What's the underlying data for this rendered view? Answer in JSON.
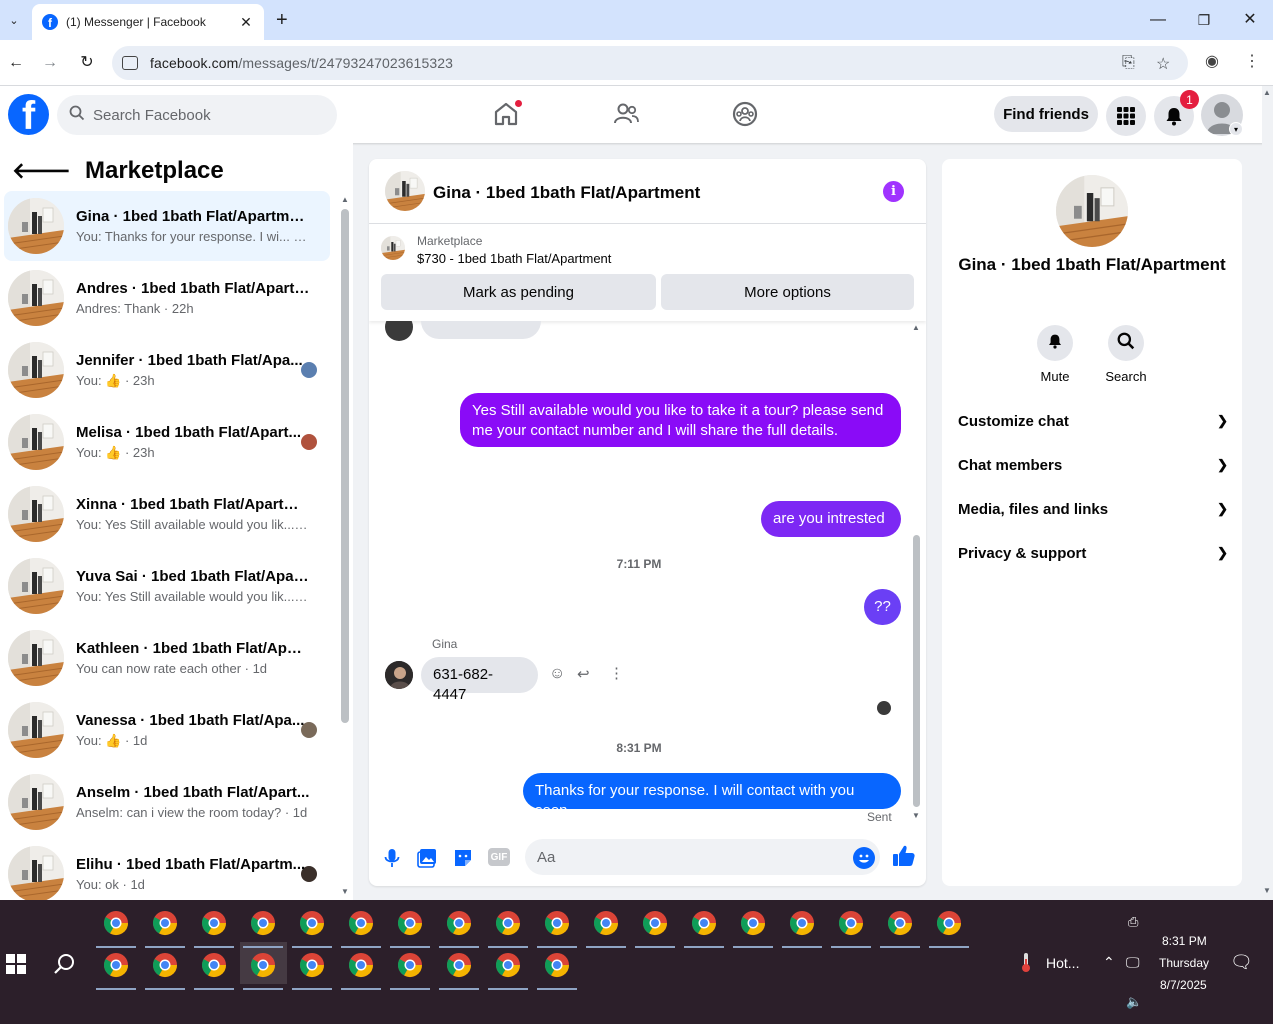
{
  "browser": {
    "tab_title": "(1) Messenger | Facebook",
    "url_host": "facebook.com",
    "url_path": "/messages/t/24793247023615323"
  },
  "header": {
    "search_placeholder": "Search Facebook",
    "find_friends": "Find friends",
    "notifications_count": "1"
  },
  "sidebar": {
    "title": "Marketplace",
    "conversations": [
      {
        "name": "Gina · 1bed 1bath Flat/Apartment",
        "preview": "You: Thanks for your response. I wi... · 1m",
        "active": true
      },
      {
        "name": "Andres · 1bed 1bath Flat/Apartm...",
        "preview": "Andres: Thank · 22h"
      },
      {
        "name": "Jennifer · 1bed 1bath Flat/Apa...",
        "preview": "You: 👍 · 23h"
      },
      {
        "name": "Melisa · 1bed 1bath Flat/Apart...",
        "preview": "You: 👍 · 23h"
      },
      {
        "name": "Xinna · 1bed 1bath Flat/Apartment",
        "preview": "You: Yes Still available would you lik... · 1d"
      },
      {
        "name": "Yuva Sai · 1bed 1bath Flat/Apart...",
        "preview": "You: Yes Still available would you lik... · 1d"
      },
      {
        "name": "Kathleen · 1bed 1bath Flat/Apart...",
        "preview": "You can now rate each other · 1d"
      },
      {
        "name": "Vanessa · 1bed 1bath Flat/Apa...",
        "preview": "You: 👍 · 1d"
      },
      {
        "name": "Anselm · 1bed 1bath Flat/Apart...",
        "preview": "Anselm: can i view the room today? · 1d"
      },
      {
        "name": "Elihu · 1bed 1bath Flat/Apartm...",
        "preview": "You: ok · 1d"
      }
    ]
  },
  "chat": {
    "title": "Gina · 1bed 1bath Flat/Apartment",
    "marketplace_label": "Marketplace",
    "listing": "$730 - 1bed 1bath Flat/Apartment",
    "mark_pending": "Mark as pending",
    "more_options": "More options",
    "messages": {
      "m1": "Yes Still available would you like to take it a tour? please send me your contact number and I will share the full details.",
      "m2": "are you  intrested",
      "ts1": "7:11 PM",
      "m3": "??",
      "sender": "Gina",
      "m4": "631-682-4447",
      "ts2": "8:31 PM",
      "m5": "Thanks for your response. I will contact with you soon",
      "status": "Sent"
    },
    "composer_placeholder": "Aa",
    "gif_label": "GIF"
  },
  "details": {
    "name": "Gina · 1bed 1bath Flat/Apartment",
    "mute": "Mute",
    "search": "Search",
    "sections": [
      "Customize chat",
      "Chat members",
      "Media, files and links",
      "Privacy & support"
    ]
  },
  "taskbar": {
    "weather": "Hot...",
    "time": "8:31 PM",
    "day": "Thursday",
    "date": "8/7/2025"
  },
  "colors": {
    "brand": "#0866ff",
    "purple_bubble": "#8a0bf7",
    "blue_bubble": "#0866ff"
  }
}
